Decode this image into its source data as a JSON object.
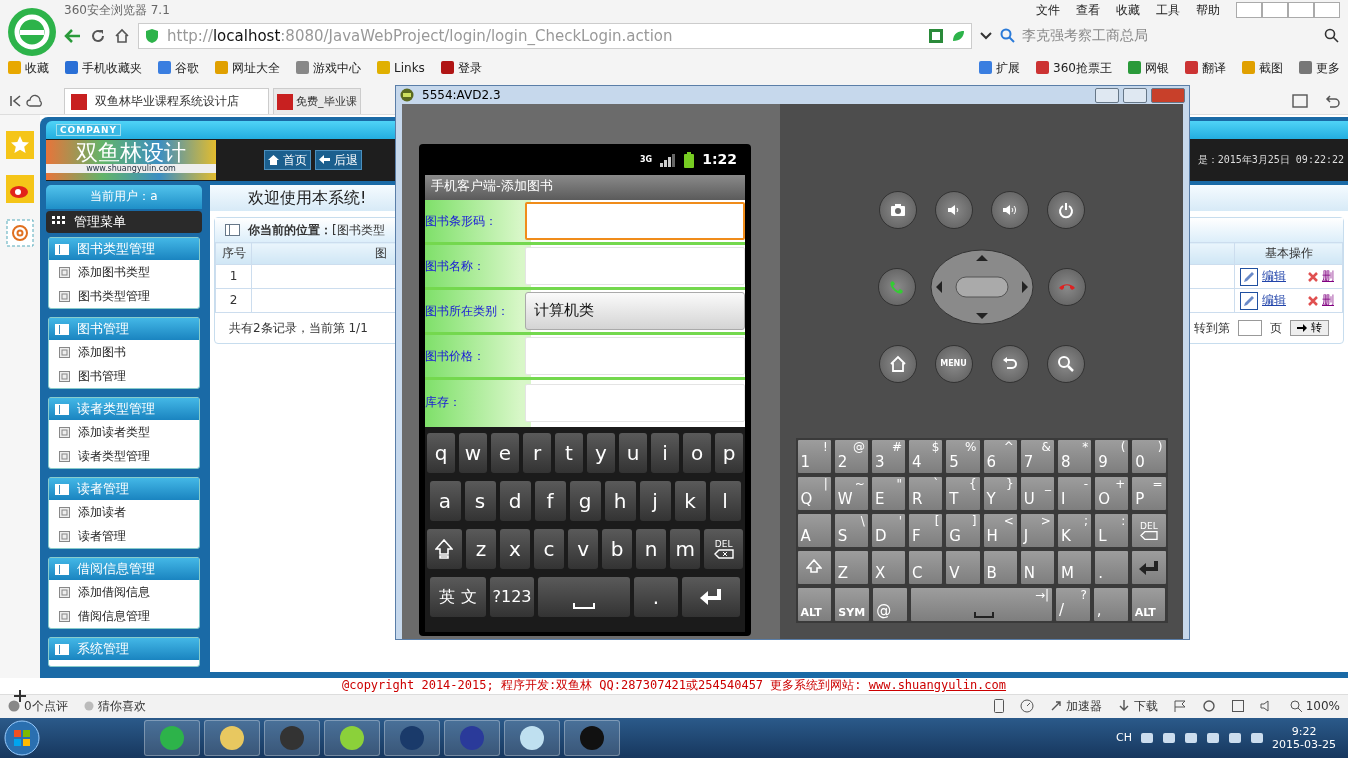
{
  "browser": {
    "title": "360安全浏览器 7.1",
    "menu": [
      "文件",
      "查看",
      "收藏",
      "工具",
      "帮助"
    ],
    "address": "http://**localhost**:8080/JavaWebProject/login/login_CheckLogin.action",
    "search": {
      "value": "李克强考察工商总局"
    },
    "bookmarks_left": [
      "收藏",
      "手机收藏夹",
      "谷歌",
      "网址大全",
      "游戏中心",
      "Links",
      "登录"
    ],
    "bookmarks_right": [
      "扩展",
      "360抢票王",
      "网银",
      "翻译",
      "截图",
      "更多"
    ],
    "tabs": [
      {
        "label": "双鱼林毕业课程系统设计店",
        "selected": true
      },
      {
        "label": "免费_毕业课",
        "selected": false
      }
    ]
  },
  "page": {
    "company": "COMPANY",
    "logo_text": "双鱼林设计",
    "logo_url": "www.shuangyulin.com",
    "nav": [
      "首页",
      "后退"
    ],
    "datetime": "是：2015年3月25日 09:22:22",
    "current_user": "当前用户：a",
    "menu_title": "管理菜单",
    "menu_groups": [
      {
        "title": "图书类型管理",
        "items": [
          "添加图书类型",
          "图书类型管理"
        ]
      },
      {
        "title": "图书管理",
        "items": [
          "添加图书",
          "图书管理"
        ]
      },
      {
        "title": "读者类型管理",
        "items": [
          "添加读者类型",
          "读者类型管理"
        ]
      },
      {
        "title": "读者管理",
        "items": [
          "添加读者",
          "读者管理"
        ]
      },
      {
        "title": "借阅信息管理",
        "items": [
          "添加借阅信息",
          "借阅信息管理"
        ]
      },
      {
        "title": "系统管理"
      }
    ],
    "welcome": "欢迎使用本系统!",
    "location": "**你当前的位置：**[图书类型",
    "table": {
      "columns": [
        "序号",
        "图",
        "基本操作"
      ],
      "rows": [
        {
          "no": "1",
          "edit": "编辑",
          "delete": "删"
        },
        {
          "no": "2",
          "edit": "编辑",
          "delete": "删"
        }
      ]
    },
    "pagination": {
      "summary": "共有2条记录，当前第 1/1",
      "goto_label": "转到第",
      "page_unit": "页",
      "go": "转"
    }
  },
  "footer": {
    "copyright": "@copyright 2014-2015; 程序开发:双鱼林  QQ:287307421或254540457  更多系统到网站: ",
    "link": "www.shuangyulin.com"
  },
  "status_bar": {
    "reviews": "0个点评",
    "guess": "猜你喜欢",
    "accelerator": "加速器",
    "download": "下载",
    "zoom": "100%"
  },
  "taskbar": {
    "ime": "CH",
    "time": "9:22",
    "date": "2015-03-25"
  },
  "emulator": {
    "title": "5554:AVD2.3",
    "network": "3G",
    "clock": "1:22",
    "app_title": "手机客户端-添加图书",
    "form": [
      {
        "label": "图书条形码：",
        "kind": "input",
        "focused": true
      },
      {
        "label": "图书名称：",
        "kind": "input",
        "focused": false
      },
      {
        "label": "图书所在类别：",
        "kind": "spinner",
        "value": "计算机类"
      },
      {
        "label": "图书价格：",
        "kind": "input",
        "focused": false
      },
      {
        "label": "库存：",
        "kind": "input",
        "focused": false
      }
    ],
    "soft_keyboard": [
      [
        {
          "kind": "char",
          "label": "q"
        },
        {
          "kind": "char",
          "label": "w"
        },
        {
          "kind": "char",
          "label": "e"
        },
        {
          "kind": "char",
          "label": "r"
        },
        {
          "kind": "char",
          "label": "t"
        },
        {
          "kind": "char",
          "label": "y"
        },
        {
          "kind": "char",
          "label": "u"
        },
        {
          "kind": "char",
          "label": "i"
        },
        {
          "kind": "char",
          "label": "o"
        },
        {
          "kind": "char",
          "label": "p"
        }
      ],
      [
        {
          "kind": "char",
          "label": "a"
        },
        {
          "kind": "char",
          "label": "s"
        },
        {
          "kind": "char",
          "label": "d"
        },
        {
          "kind": "char",
          "label": "f"
        },
        {
          "kind": "char",
          "label": "g"
        },
        {
          "kind": "char",
          "label": "h"
        },
        {
          "kind": "char",
          "label": "j"
        },
        {
          "kind": "char",
          "label": "k"
        },
        {
          "kind": "char",
          "label": "l"
        }
      ],
      [
        {
          "kind": "shift"
        },
        {
          "kind": "char",
          "label": "z"
        },
        {
          "kind": "char",
          "label": "x"
        },
        {
          "kind": "char",
          "label": "c"
        },
        {
          "kind": "char",
          "label": "v"
        },
        {
          "kind": "char",
          "label": "b"
        },
        {
          "kind": "char",
          "label": "n"
        },
        {
          "kind": "char",
          "label": "m"
        },
        {
          "kind": "del",
          "label": "DEL"
        }
      ],
      [
        {
          "kind": "mode",
          "label": "英 文"
        },
        {
          "kind": "mode",
          "label": "?123"
        },
        {
          "kind": "space"
        },
        {
          "kind": "char",
          "label": "."
        },
        {
          "kind": "enter"
        }
      ]
    ],
    "controls": [
      [
        {
          "kind": "camera"
        },
        {
          "kind": "volume_down"
        },
        {
          "kind": "volume_up"
        },
        {
          "kind": "power"
        }
      ],
      [
        {
          "kind": "call"
        },
        {
          "kind": "dpad"
        },
        {
          "kind": "end_call"
        }
      ],
      [
        {
          "kind": "home"
        },
        {
          "kind": "menu",
          "label": "MENU"
        },
        {
          "kind": "back"
        },
        {
          "kind": "search"
        }
      ]
    ],
    "hardware_keyboard": [
      [
        {
          "kind": "key",
          "main": "1",
          "alt": "!"
        },
        {
          "kind": "key",
          "main": "2",
          "alt": "@"
        },
        {
          "kind": "key",
          "main": "3",
          "alt": "#"
        },
        {
          "kind": "key",
          "main": "4",
          "alt": "$"
        },
        {
          "kind": "key",
          "main": "5",
          "alt": "%"
        },
        {
          "kind": "key",
          "main": "6",
          "alt": "^"
        },
        {
          "kind": "key",
          "main": "7",
          "alt": "&"
        },
        {
          "kind": "key",
          "main": "8",
          "alt": "*"
        },
        {
          "kind": "key",
          "main": "9",
          "alt": "("
        },
        {
          "kind": "key",
          "main": "0",
          "alt": ")"
        }
      ],
      [
        {
          "kind": "key",
          "main": "Q",
          "alt": "|"
        },
        {
          "kind": "key",
          "main": "W",
          "alt": "~"
        },
        {
          "kind": "key",
          "main": "E",
          "alt": "\""
        },
        {
          "kind": "key",
          "main": "R",
          "alt": "`"
        },
        {
          "kind": "key",
          "main": "T",
          "alt": "{"
        },
        {
          "kind": "key",
          "main": "Y",
          "alt": "}"
        },
        {
          "kind": "key",
          "main": "U",
          "alt": "_"
        },
        {
          "kind": "key",
          "main": "I",
          "alt": "-"
        },
        {
          "kind": "key",
          "main": "O",
          "alt": "+"
        },
        {
          "kind": "key",
          "main": "P",
          "alt": "="
        }
      ],
      [
        {
          "kind": "key",
          "main": "A"
        },
        {
          "kind": "key",
          "main": "S",
          "alt": "\\"
        },
        {
          "kind": "key",
          "main": "D",
          "alt": "'"
        },
        {
          "kind": "key",
          "main": "F",
          "alt": "["
        },
        {
          "kind": "key",
          "main": "G",
          "alt": "]"
        },
        {
          "kind": "key",
          "main": "H",
          "alt": "<"
        },
        {
          "kind": "key",
          "main": "J",
          "alt": ">"
        },
        {
          "kind": "key",
          "main": "K",
          "alt": ";"
        },
        {
          "kind": "key",
          "main": "L",
          "alt": ":"
        },
        {
          "kind": "del",
          "main": "DEL"
        }
      ],
      [
        {
          "kind": "shift"
        },
        {
          "kind": "key",
          "main": "Z"
        },
        {
          "kind": "key",
          "main": "X"
        },
        {
          "kind": "key",
          "main": "C"
        },
        {
          "kind": "key",
          "main": "V"
        },
        {
          "kind": "key",
          "main": "B"
        },
        {
          "kind": "key",
          "main": "N"
        },
        {
          "kind": "key",
          "main": "M"
        },
        {
          "kind": "key",
          "main": "."
        },
        {
          "kind": "enter"
        }
      ],
      [
        {
          "kind": "mod",
          "main": "ALT"
        },
        {
          "kind": "mod",
          "main": "SYM"
        },
        {
          "kind": "key",
          "main": "@"
        },
        {
          "kind": "space",
          "alt": "→|"
        },
        {
          "kind": "key",
          "main": "/",
          "alt": "?"
        },
        {
          "kind": "key",
          "main": ","
        },
        {
          "kind": "mod",
          "main": "ALT"
        }
      ]
    ]
  }
}
